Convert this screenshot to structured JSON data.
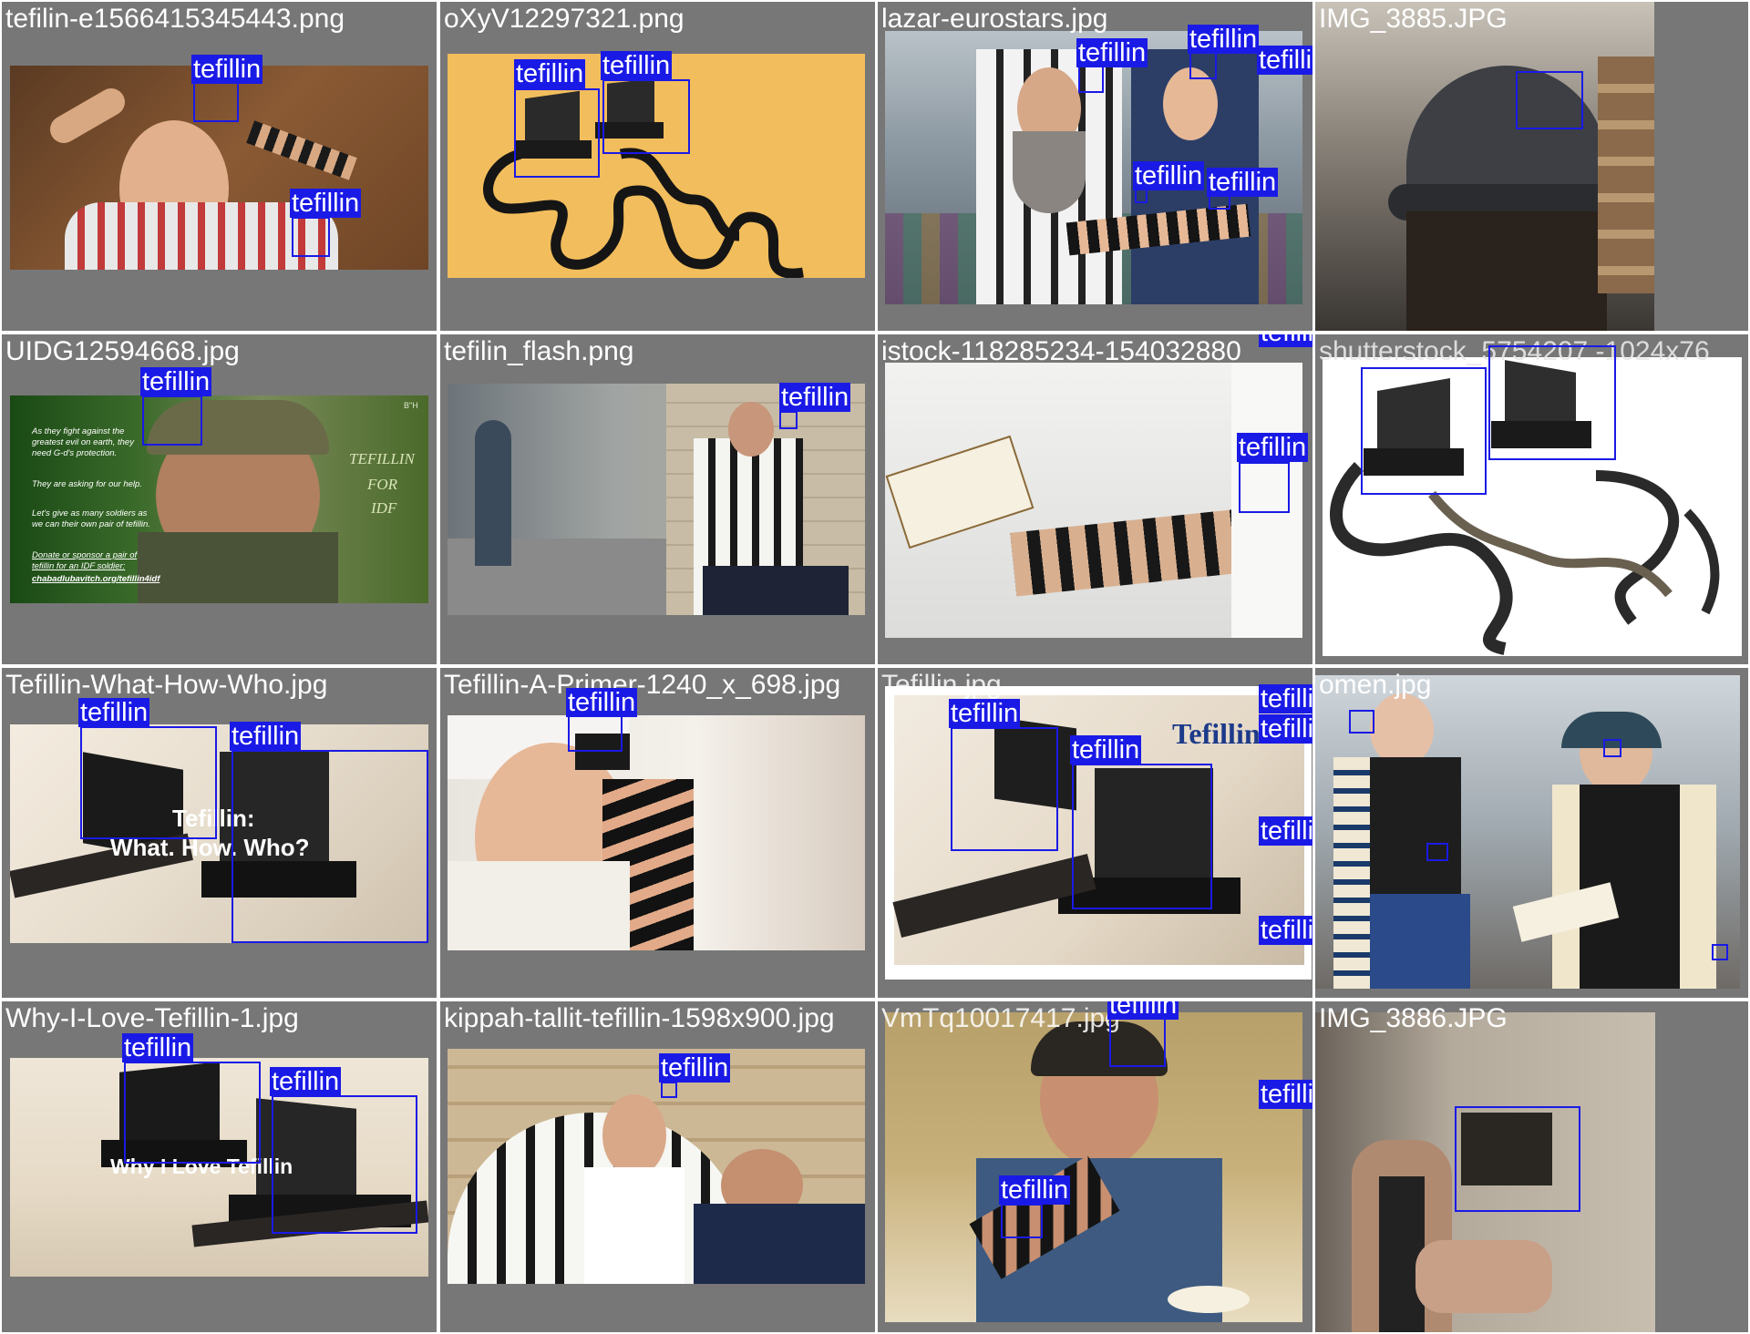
{
  "colors": {
    "box": "#1a1ae6",
    "tile_bg": "#777777",
    "grid_line": "#ffffff"
  },
  "tiles": [
    {
      "filename": "tefilin-e1566415345443.png",
      "box_labels": [
        "tefillin",
        "tefillin"
      ],
      "icon": "photo-boy-with-tefillin"
    },
    {
      "filename": "oXyV12297321.png",
      "box_labels": [
        "tefillin",
        "tefillin"
      ],
      "icon": "illustration-tefillin-boxes"
    },
    {
      "filename": "lazar-eurostars.jpg",
      "box_labels": [
        "tefillin",
        "tefillin",
        "tefillin",
        "tefillin",
        "tefillin"
      ],
      "icon": "photo-rabbi-and-young-man"
    },
    {
      "filename": "IMG_3885.JPG",
      "box_labels": [],
      "icon": "photo-cap-with-tefillin"
    },
    {
      "filename": "UIDG12594668.jpg",
      "box_labels": [
        "tefillin"
      ],
      "icon": "photo-soldier",
      "overlay": {
        "top_right": "B\"H",
        "title_lines": [
          "TEFILLIN",
          "FOR",
          "IDF"
        ],
        "paragraphs": [
          "As they fight against the greatest evil on earth, they need G-d's protection.",
          "They are asking for our help.",
          "Let's give as many soldiers as we can their own pair of tefillin."
        ],
        "cta": "Donate or sponsor a pair of tefillin for an IDF soldier:",
        "link": "chabadlubavitch.org/tefillin4idf"
      }
    },
    {
      "filename": "tefilin_flash.png",
      "box_labels": [
        "tefillin"
      ],
      "icon": "photo-man-reading-on-street"
    },
    {
      "filename": "istock-118285234-154032880",
      "box_labels": [
        "tefillin",
        "tefillin"
      ],
      "icon": "photo-arm-holding-book"
    },
    {
      "filename": "shutterstock_5754207 -1024x76",
      "box_labels": [],
      "icon": "photo-tefillin-set-white"
    },
    {
      "filename": "Tefillin-What-How-Who.jpg",
      "box_labels": [
        "tefillin",
        "tefillin"
      ],
      "icon": "photo-tefillin-closeup",
      "overlay": {
        "lines": [
          "Tefillin:",
          "What. How. Who?"
        ]
      }
    },
    {
      "filename": "Tefillin-A-Primer-1240_x_698.jpg",
      "box_labels": [
        "tefillin"
      ],
      "icon": "photo-boy-praying"
    },
    {
      "filename": "Tefillin.jpg",
      "box_labels": [
        "tefillin",
        "tefillin",
        "tefillin",
        "tefillin",
        "tefillin",
        "tefillin"
      ],
      "icon": "photo-tefillin-banner",
      "overlay": {
        "title": "Tefillin"
      }
    },
    {
      "filename": "omen.jpg",
      "box_labels": [],
      "icon": "photo-two-women"
    },
    {
      "filename": "Why-I-Love-Tefillin-1.jpg",
      "box_labels": [
        "tefillin",
        "tefillin"
      ],
      "icon": "photo-tefillin-on-cloth",
      "overlay": {
        "title": "Why I Love Tefillin"
      }
    },
    {
      "filename": "kippah-tallit-tefillin-1598x900.jpg",
      "box_labels": [
        "tefillin"
      ],
      "icon": "photo-kotel-tallit"
    },
    {
      "filename": "VmTq10017417.jpg",
      "box_labels": [
        "tefillin",
        "tefillin",
        "tefillin"
      ],
      "icon": "photo-man-covering-eyes"
    },
    {
      "filename": "IMG_3886.JPG",
      "box_labels": [],
      "icon": "photo-hand-with-tefillin"
    }
  ]
}
